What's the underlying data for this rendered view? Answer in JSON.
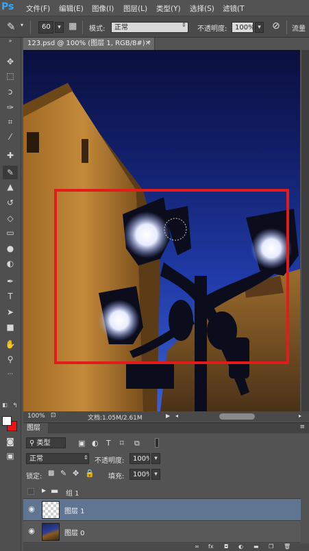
{
  "menu": {
    "logo": "Ps",
    "items": [
      "文件(F)",
      "编辑(E)",
      "图像(I)",
      "图层(L)",
      "类型(Y)",
      "选择(S)",
      "滤镜(T"
    ]
  },
  "options": {
    "brush_size": "60",
    "mode_label": "模式:",
    "mode_value": "正常",
    "opacity_label": "不透明度:",
    "opacity_value": "100%",
    "flow_label": "流量"
  },
  "document": {
    "tab_title": "123.psd @ 100% (图层 1, RGB/8#) *",
    "zoom": "100%",
    "doc_info": "文档:1.05M/2.61M"
  },
  "layers_panel": {
    "tab_label": "图层",
    "filter_label": "类型",
    "blend_mode": "正常",
    "opacity_label": "不透明度:",
    "opacity_value": "100%",
    "lock_label": "锁定:",
    "fill_label": "填充:",
    "fill_value": "100%",
    "group_name": "组 1",
    "layers": [
      {
        "name": "图层 1",
        "selected": true
      },
      {
        "name": "图层 0",
        "selected": false
      }
    ]
  },
  "colors": {
    "selection_frame": "#e31b1b",
    "foreground": "#ffffff",
    "background": "#e11111",
    "accent": "#31a8ff"
  }
}
